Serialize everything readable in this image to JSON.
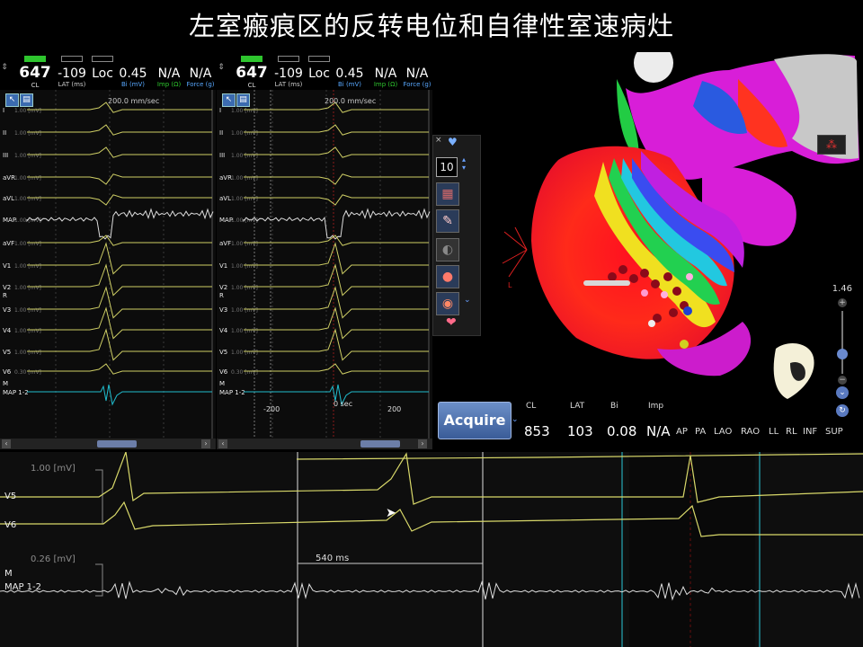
{
  "title": "左室瘢痕区的反转电位和自律性室速病灶",
  "header_stats": [
    {
      "value": "647",
      "unit": "CL",
      "kind": "cl",
      "bar": "green"
    },
    {
      "value": "-109",
      "unit": "LAT (ms)",
      "kind": "lat",
      "bar": "empty"
    },
    {
      "value": "Loc",
      "unit": "",
      "kind": "loc",
      "bar": "empty"
    },
    {
      "value": "0.45",
      "unit": "Bi (mV)",
      "kind": "bi",
      "bar": "none"
    },
    {
      "value": "N/A",
      "unit": "Imp (Ω)",
      "kind": "imp",
      "bar": "none"
    },
    {
      "value": "N/A",
      "unit": "Force (g)",
      "kind": "force",
      "bar": "none"
    }
  ],
  "sweep_speed": "200.0 mm/sec",
  "channels": [
    {
      "name": "I",
      "scale": "1.00  [mV]"
    },
    {
      "name": "II",
      "scale": "1.00  [mV]"
    },
    {
      "name": "III",
      "scale": "1.00  [mV]"
    },
    {
      "name": "aVR",
      "scale": "1.00  [mV]"
    },
    {
      "name": "aVL",
      "scale": "1.00  [mV]"
    },
    {
      "name": "MAP",
      "scale": "1.00  [mV]"
    },
    {
      "name": "aVF",
      "scale": "1.00  [mV]"
    },
    {
      "name": "V1",
      "scale": "1.00  [mV]"
    },
    {
      "name": "V2",
      "scale": "1.00  [mV]"
    },
    {
      "name": "V3",
      "scale": "1.00  [mV]"
    },
    {
      "name": "V4",
      "scale": "1.00  [mV]"
    },
    {
      "name": "V5",
      "scale": "1.00  [mV]"
    },
    {
      "name": "V6",
      "scale": "0.30  [mV]"
    },
    {
      "name": "MAP 1-2",
      "scale": ""
    }
  ],
  "extra_labels": {
    "r": "R",
    "m": "M"
  },
  "panel2_time_ticks": [
    "-200",
    "0 sec",
    "200"
  ],
  "map_toolbox": {
    "number": "10"
  },
  "map_bottom": {
    "acquire_label": "Acquire",
    "cl_label": "CL",
    "cl_value": "853",
    "lat_label": "LAT",
    "lat_value": "103",
    "bi_label": "Bi",
    "bi_value": "0.08",
    "imp_label": "Imp",
    "imp_value": "N/A",
    "views": [
      "AP",
      "PA",
      "LAO",
      "RAO",
      "LL",
      "RL",
      "INF",
      "SUP"
    ]
  },
  "zoom_level": "1.46",
  "strip": {
    "v_scale": "1.00  [mV]",
    "v5_label": "V5",
    "v6_label": "V6",
    "map_scale": "0.26  [mV]",
    "m_label": "M",
    "map_label": "MAP 1-2",
    "measurement": "540 ms"
  },
  "colors": {
    "trace": "#d9d96a",
    "map_trace": "#22c6d8",
    "accent": "#2ec52e",
    "blue_label": "#58a8ff"
  }
}
